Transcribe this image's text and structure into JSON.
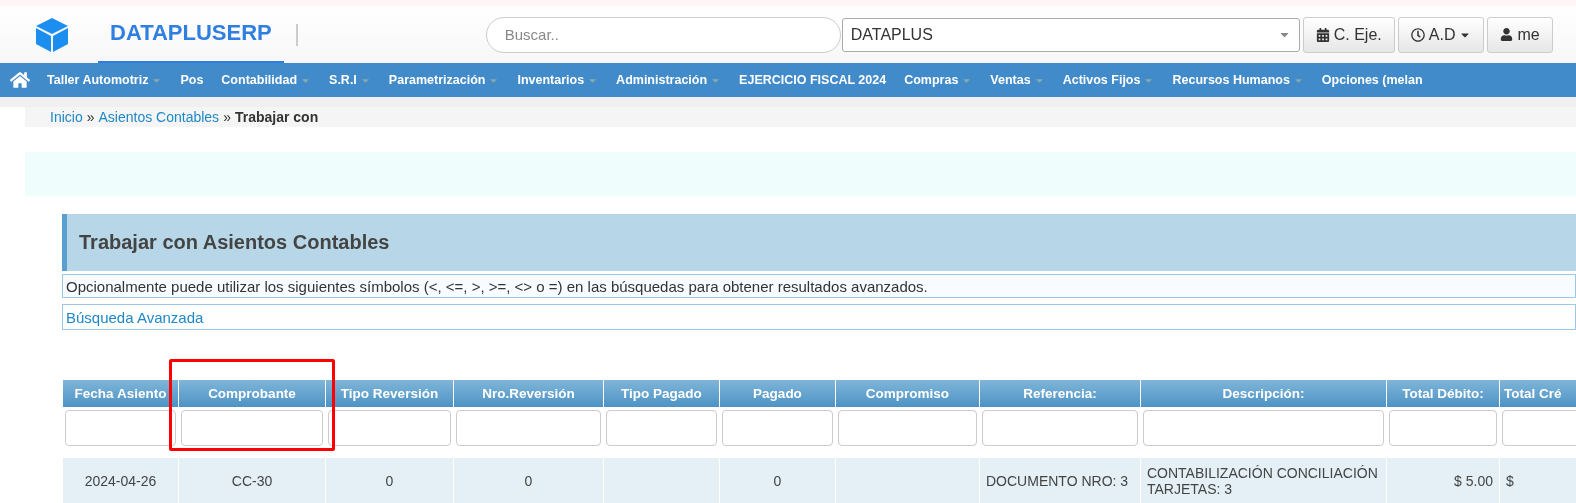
{
  "header": {
    "brand": "DATAPLUSERP",
    "search": {
      "placeholder": "Buscar.."
    },
    "company_select": {
      "value": "DATAPLUS"
    },
    "buttons": [
      {
        "label": "C. Eje.",
        "kind": "calendar",
        "caret": false
      },
      {
        "label": "A.D",
        "kind": "clock",
        "caret": true
      },
      {
        "label": "me",
        "kind": "user",
        "caret": false
      }
    ]
  },
  "nav": {
    "items": [
      {
        "label": "Taller Automotriz",
        "submenu": true
      },
      {
        "label": "Pos",
        "submenu": false
      },
      {
        "label": "Contabilidad",
        "submenu": true
      },
      {
        "label": "S.R.I",
        "submenu": true
      },
      {
        "label": "Parametrización",
        "submenu": true
      },
      {
        "label": "Inventarios",
        "submenu": true
      },
      {
        "label": "Administración",
        "submenu": true
      },
      {
        "label": "EJERCICIO FISCAL 2024",
        "submenu": false
      },
      {
        "label": "Compras",
        "submenu": true
      },
      {
        "label": "Ventas",
        "submenu": true
      },
      {
        "label": "Activos Fijos",
        "submenu": true
      },
      {
        "label": "Recursos Humanos",
        "submenu": true
      },
      {
        "label": "Opciones (melan",
        "submenu": false
      }
    ]
  },
  "breadcrumb": [
    {
      "label": "Inicio",
      "kind": "link"
    },
    {
      "label": "»",
      "kind": "sep"
    },
    {
      "label": "Asientos Contables",
      "kind": "link"
    },
    {
      "label": "»",
      "kind": "sep"
    },
    {
      "label": "Trabajar con",
      "kind": "current"
    }
  ],
  "panel": {
    "title": "Trabajar con Asientos Contables",
    "hint": "Opcionalmente puede utilizar los siguientes símbolos (<, <=, >, >=, <> o =) en las búsquedas para obtener resultados avanzados.",
    "advanced_search": "Búsqueda Avanzada"
  },
  "table": {
    "columns": [
      {
        "label": "Fecha Asiento",
        "highlighted": false
      },
      {
        "label": "Comprobante",
        "highlighted": true
      },
      {
        "label": "Tipo Reversión",
        "highlighted": false
      },
      {
        "label": "Nro.Reversión",
        "highlighted": false
      },
      {
        "label": "Tipo Pagado",
        "highlighted": false
      },
      {
        "label": "Pagado",
        "highlighted": false
      },
      {
        "label": "Compromiso",
        "highlighted": false
      },
      {
        "label": "Referencia:",
        "highlighted": false
      },
      {
        "label": "Descripción:",
        "highlighted": false
      },
      {
        "label": "Total Débito:",
        "highlighted": false
      },
      {
        "label": "Total Cré",
        "highlighted": false
      }
    ],
    "rows": [
      {
        "cells": [
          "2024-04-26",
          "CC-30",
          "0",
          "0",
          "",
          "0",
          "",
          "DOCUMENTO NRO: 3",
          "CONTABILIZACIÓN CONCILIACIÓN TARJETAS: 3",
          "$ 5.00",
          "$"
        ]
      }
    ]
  }
}
